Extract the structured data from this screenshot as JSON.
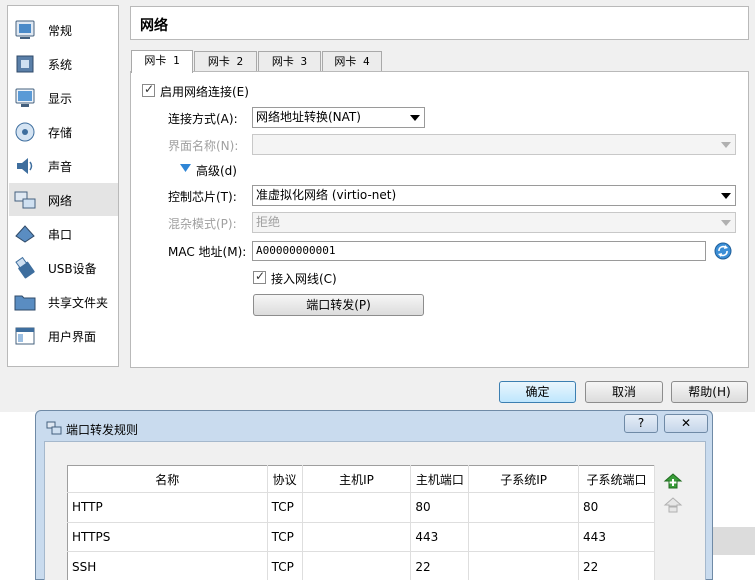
{
  "sidebar": {
    "items": [
      {
        "label": "常规",
        "icon": "general-icon"
      },
      {
        "label": "系统",
        "icon": "system-icon"
      },
      {
        "label": "显示",
        "icon": "display-icon"
      },
      {
        "label": "存储",
        "icon": "storage-icon"
      },
      {
        "label": "声音",
        "icon": "audio-icon"
      },
      {
        "label": "网络",
        "icon": "network-icon",
        "selected": true
      },
      {
        "label": "串口",
        "icon": "serial-port-icon"
      },
      {
        "label": "USB设备",
        "icon": "usb-icon"
      },
      {
        "label": "共享文件夹",
        "icon": "shared-folder-icon"
      },
      {
        "label": "用户界面",
        "icon": "user-interface-icon"
      }
    ]
  },
  "header": {
    "title": "网络"
  },
  "tabs": [
    {
      "label": "网卡 1",
      "active": true
    },
    {
      "label": "网卡 2"
    },
    {
      "label": "网卡 3"
    },
    {
      "label": "网卡 4"
    }
  ],
  "adapter": {
    "enable_label": "启用网络连接(E)",
    "enabled": true,
    "attach_label": "连接方式(A):",
    "attach_value": "网络地址转换(NAT)",
    "name_label": "界面名称(N):",
    "name_value": "",
    "advanced_label": "高级(d)",
    "chip_label": "控制芯片(T):",
    "chip_value": "准虚拟化网络 (virtio-net)",
    "promisc_label": "混杂模式(P):",
    "promisc_value": "拒绝",
    "mac_label": "MAC 地址(M):",
    "mac_value": "A00000000001",
    "cable_label": "接入网线(C)",
    "cable_connected": true,
    "port_forward_label": "端口转发(P)"
  },
  "buttons": {
    "ok": "确定",
    "cancel": "取消",
    "help": "帮助(H)"
  },
  "dialog": {
    "title": "端口转发规则",
    "help_glyph": "?",
    "close_glyph": "✕",
    "columns": [
      "名称",
      "协议",
      "主机IP",
      "主机端口",
      "子系统IP",
      "子系统端口"
    ],
    "rows": [
      {
        "name": "HTTP",
        "protocol": "TCP",
        "host_ip": "",
        "host_port": "80",
        "guest_ip": "",
        "guest_port": "80"
      },
      {
        "name": "HTTPS",
        "protocol": "TCP",
        "host_ip": "",
        "host_port": "443",
        "guest_ip": "",
        "guest_port": "443"
      },
      {
        "name": "SSH",
        "protocol": "TCP",
        "host_ip": "",
        "host_port": "22",
        "guest_ip": "",
        "guest_port": "22"
      }
    ]
  },
  "colors": {
    "accent": "#3c7fb1",
    "dialog_frame": "#c9dbee",
    "add_icon": "#3a9d3a"
  }
}
